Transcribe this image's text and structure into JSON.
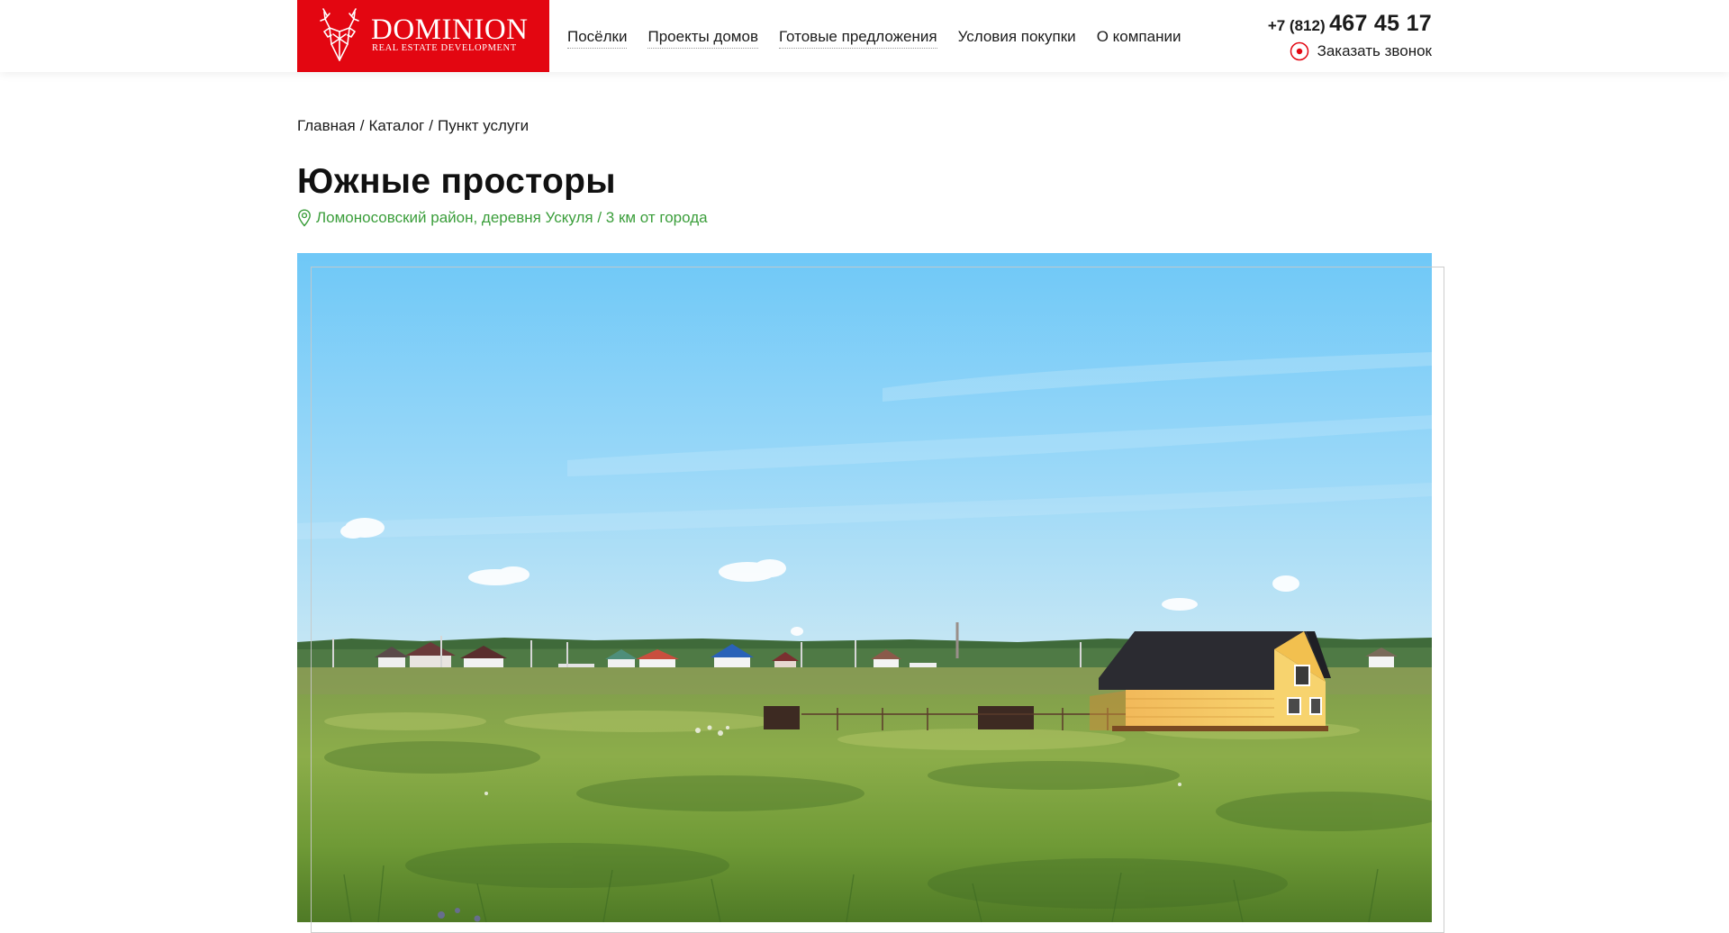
{
  "header": {
    "logo": {
      "title": "DOMINION",
      "subtitle": "REAL ESTATE DEVELOPMENT",
      "icon": "deer-head-icon",
      "brand_color": "#e30611"
    },
    "nav": [
      {
        "label": "Посёлки"
      },
      {
        "label": "Проекты домов"
      },
      {
        "label": "Готовые предложения"
      },
      {
        "label": "Условия покупки"
      },
      {
        "label": "О компании"
      }
    ],
    "phone": {
      "code": "+7 (812)",
      "number": "467 45 17"
    },
    "callback": {
      "label": "Заказать звонок",
      "icon": "record-dot-icon"
    }
  },
  "breadcrumb": [
    {
      "label": "Главная"
    },
    {
      "label": "Каталог"
    },
    {
      "label": "Пункт услуги"
    }
  ],
  "breadcrumb_separator": "/",
  "page": {
    "title": "Южные просторы",
    "location": "Ломоносовский район, деревня Ускуля / 3 км от города",
    "location_icon": "map-pin-icon",
    "accent_color": "#3b9e3b"
  },
  "hero": {
    "image": "village-field-photo"
  }
}
